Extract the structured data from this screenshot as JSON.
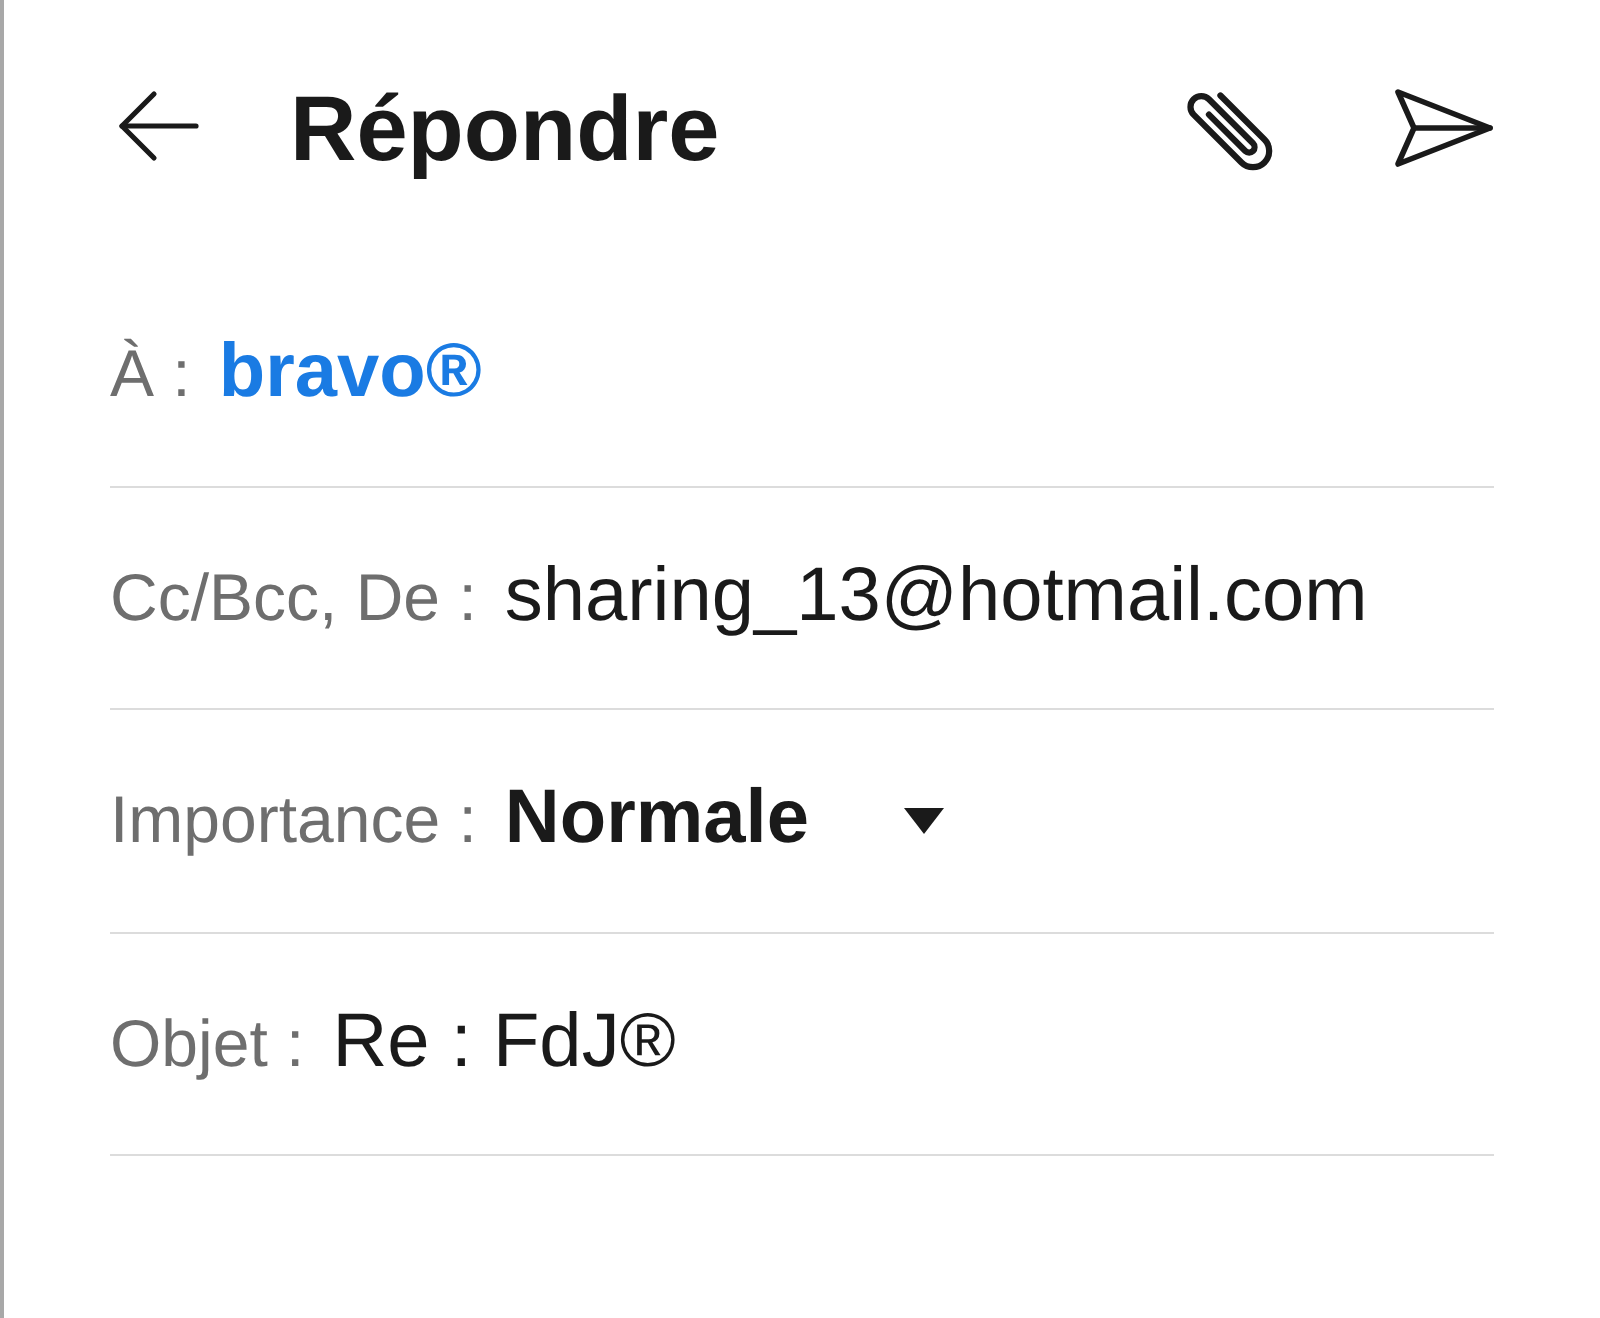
{
  "header": {
    "title": "Répondre"
  },
  "fields": [
    {
      "kind": "recipients",
      "label": "À :",
      "value": "bravo®"
    },
    {
      "kind": "text",
      "label": "Cc/Bcc, De :",
      "value": "sharing_13@hotmail.com"
    },
    {
      "kind": "dropdown",
      "label": "Importance :",
      "value": "Normale"
    },
    {
      "kind": "text",
      "label": "Objet :",
      "value": "Re : FdJ®"
    }
  ]
}
